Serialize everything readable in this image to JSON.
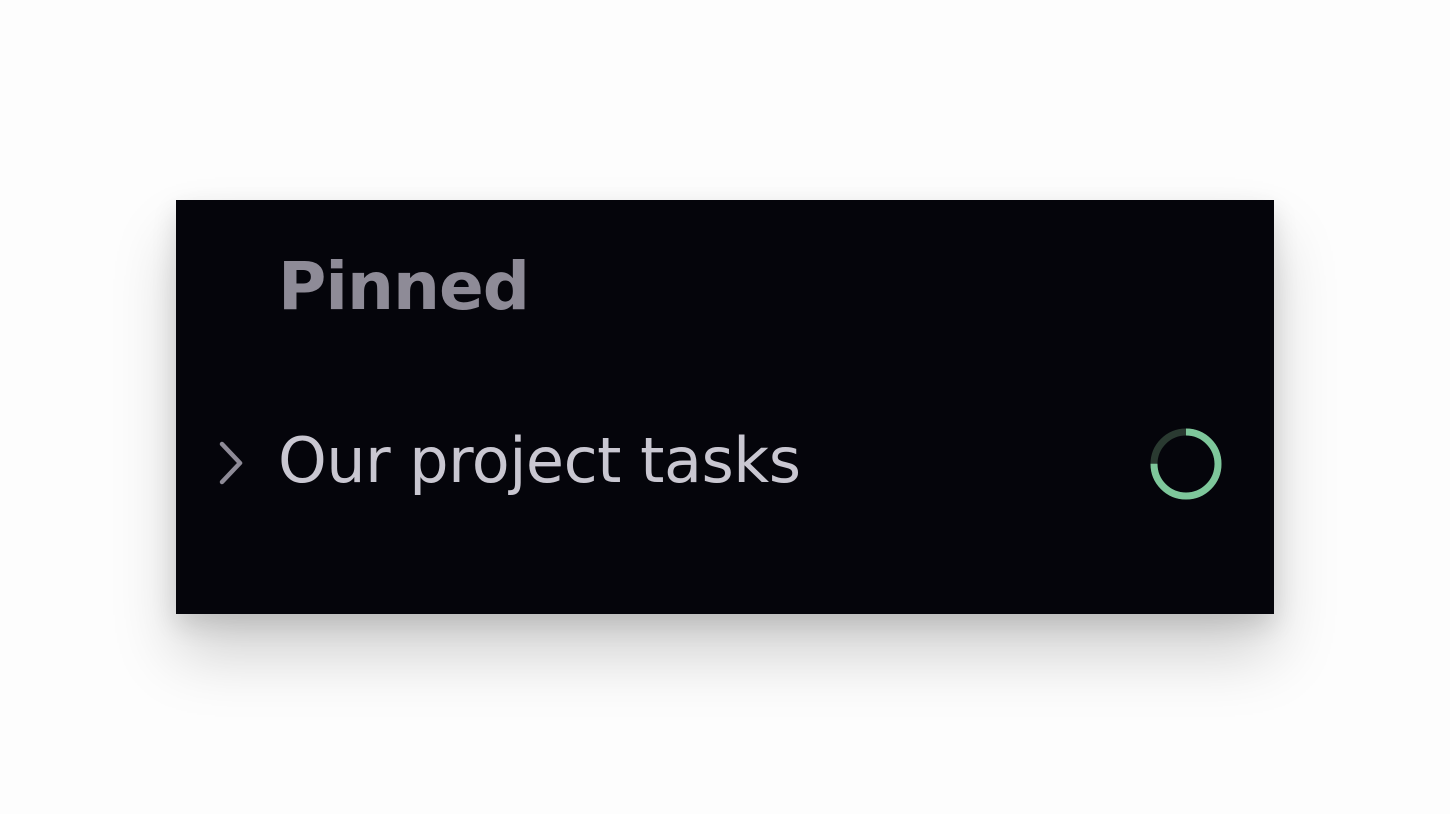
{
  "sidebar": {
    "section": {
      "heading": "Pinned",
      "items": [
        {
          "label": "Our project tasks",
          "expanded": false,
          "chevron_icon": "chevron-right-icon",
          "status_icon": "progress-ring-icon",
          "progress": 0.75
        }
      ]
    }
  },
  "colors": {
    "panel_background": "#05050b",
    "page_background": "#fdfdfd",
    "heading_text": "#8e8b97",
    "item_text": "#c9c7d1",
    "chevron": "#8e8b97",
    "progress_ring": "#7ec79b",
    "progress_track": "#2a3a31"
  }
}
